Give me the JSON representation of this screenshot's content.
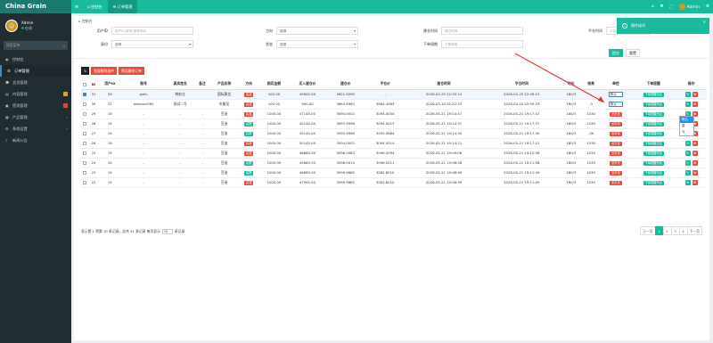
{
  "app": {
    "title": "China Grain"
  },
  "user": {
    "name": "Admin",
    "status": "在线",
    "short": "Admin"
  },
  "sidebar": {
    "search_placeholder": "搜索菜单",
    "items": [
      {
        "label": "控制台",
        "icon": "dashboard-icon"
      },
      {
        "label": "订单管理",
        "icon": "list-icon",
        "active": true
      },
      {
        "label": "会员管理",
        "icon": "user-icon"
      },
      {
        "label": "内容管理",
        "icon": "file-icon",
        "badge": "orange"
      },
      {
        "label": "提现管理",
        "icon": "wallet-icon",
        "badge": "red"
      },
      {
        "label": "产品管理",
        "icon": "box-icon",
        "chevron": true
      },
      {
        "label": "系统设置",
        "icon": "gear-icon",
        "chevron": true
      },
      {
        "label": "新闻公告",
        "icon": "bell-icon"
      }
    ]
  },
  "topbar": {
    "tabs": [
      {
        "label": "控制台"
      },
      {
        "label": "订单管理"
      }
    ],
    "username": "Admin"
  },
  "breadcrumb": "控制台",
  "filters": {
    "user_id": {
      "label": "用户ID",
      "placeholder": "用户ID/账号/推荐号码"
    },
    "direction": {
      "label": "方向",
      "value": "选择"
    },
    "close_time": {
      "label": "建仓时间",
      "placeholder": "建仓时间"
    },
    "close_price": {
      "label": "平仓时间",
      "placeholder": "平仓时间"
    },
    "proxy": {
      "label": "身份",
      "value": "选择"
    },
    "status": {
      "label": "状态",
      "value": "选择"
    },
    "order_time": {
      "label": "下单周期",
      "placeholder": "下单周期"
    },
    "submit": "提交",
    "reset": "重置"
  },
  "toolbar": {
    "refresh_icon": "refresh-icon",
    "bulk_delete": "批量删除选中",
    "pre_delete": "预设删除订单"
  },
  "table": {
    "headers": [
      "ID",
      "用户ID",
      "账号",
      "真实姓名",
      "备注",
      "产品名称",
      "方向",
      "购买金额",
      "买入建仓价",
      "建仓价",
      "平仓价",
      "建仓时间",
      "平仓时间",
      "时长",
      "结果",
      "单控",
      "下单提醒",
      "操作"
    ],
    "rows": [
      {
        "id": "31",
        "uid": "29",
        "acct": "gxlin",
        "name": "韩杜仕",
        "note": "",
        "product": "国际黄金",
        "dir": "买涨",
        "amount": "100.00",
        "buy": "49900.00",
        "open": "4621.9295",
        "close": "-",
        "t1": "2026-03-25 22:35:14",
        "t2": "2026-03-25 22:40:13",
        "dur": "180/3",
        "res": "",
        "ctrl": "默认",
        "remind": "下单提醒开启",
        "selected": true
      },
      {
        "id": "30",
        "uid": "21",
        "acct": "testuser062",
        "name": "测试二号",
        "note": "",
        "product": "车厘吴",
        "dir": "买涨",
        "amount": "100.00",
        "buy": "900.00",
        "open": "3664.4983",
        "close": "3664.4983",
        "t1": "2026-03-10 02:52:23",
        "t2": "2026-03-10 02:55:23",
        "dur": "180/3",
        "res": "-3",
        "ctrl": "默认",
        "remind": "下单提醒开启"
      },
      {
        "id": "29",
        "uid": "19",
        "acct": "-",
        "name": "-",
        "note": "-",
        "product": "豆油",
        "dir": "买涨",
        "amount": "1000.00",
        "buy": "47145.00",
        "open": "3094.0002",
        "close": "3094.0004",
        "t1": "2026-05-21 19:14:47",
        "t2": "2026-05-21 19:17:47",
        "dur": "180/3",
        "res": "1030",
        "ctrl": "全平仓",
        "remind": "下单提醒开启"
      },
      {
        "id": "28",
        "uid": "19",
        "acct": "-",
        "name": "-",
        "note": "-",
        "product": "豆油",
        "dir": "买跌",
        "amount": "1000.00",
        "buy": "45145.00",
        "open": "3093.9996",
        "close": "3094.0013",
        "t1": "2026-05-21 19:14:37",
        "t2": "2026-05-21 19:17:37",
        "dur": "180/3",
        "res": "1030",
        "ctrl": "全平仓",
        "remind": "下单提醒开启"
      },
      {
        "id": "27",
        "uid": "19",
        "acct": "-",
        "name": "-",
        "note": "-",
        "product": "豆油",
        "dir": "买跌",
        "amount": "1000.00",
        "buy": "45145.00",
        "open": "3093.9996",
        "close": "3093.9984",
        "t1": "2026-05-21 19:14:30",
        "t2": "2026-05-21 19:17:30",
        "dur": "180/3",
        "res": "-30",
        "ctrl": "全平仓",
        "remind": "下单提醒开启"
      },
      {
        "id": "26",
        "uid": "19",
        "acct": "-",
        "name": "-",
        "note": "-",
        "product": "豆油",
        "dir": "买涨",
        "amount": "1000.00",
        "buy": "50145.00",
        "open": "3094.0002",
        "close": "3094.0014",
        "t1": "2026-05-21 19:14:21",
        "t2": "2026-05-21 19:17:21",
        "dur": "180/3",
        "res": "1030",
        "ctrl": "全平仓",
        "remind": "下单提醒开启"
      },
      {
        "id": "25",
        "uid": "19",
        "acct": "-",
        "name": "-",
        "note": "-",
        "product": "豆油",
        "dir": "买涨",
        "amount": "1000.00",
        "buy": "46860.00",
        "open": "3096.0083",
        "close": "3096.0094",
        "t1": "2026-05-21 19:09:06",
        "t2": "2026-05-21 19:12:06",
        "dur": "180/3",
        "res": "1030",
        "ctrl": "全平仓",
        "remind": "下单提醒开启"
      },
      {
        "id": "24",
        "uid": "19",
        "acct": "-",
        "name": "-",
        "note": "-",
        "product": "豆油",
        "dir": "买跌",
        "amount": "1000.00",
        "buy": "45860.00",
        "open": "3096.0014",
        "close": "3096.0011",
        "t1": "2026-05-21 19:08:58",
        "t2": "2026-05-21 19:11:58",
        "dur": "180/3",
        "res": "1030",
        "ctrl": "全平仓",
        "remind": "下单提醒开启"
      },
      {
        "id": "23",
        "uid": "19",
        "acct": "-",
        "name": "-",
        "note": "-",
        "product": "豆油",
        "dir": "买跌",
        "amount": "1000.00",
        "buy": "46860.00",
        "open": "3099.9885",
        "close": "3082.6010",
        "t1": "2026-05-21 19:08:49",
        "t2": "2026-05-21 19:11:49",
        "dur": "180/3",
        "res": "1030",
        "ctrl": "全平仓",
        "remind": "下单提醒开启"
      },
      {
        "id": "22",
        "uid": "19",
        "acct": "-",
        "name": "-",
        "note": "-",
        "product": "豆油",
        "dir": "买涨",
        "amount": "1000.00",
        "buy": "47900.00",
        "open": "3099.9885",
        "close": "3082.6010",
        "t1": "2026-05-21 19:08:49",
        "t2": "2026-05-21 19:11:49",
        "dur": "180/3",
        "res": "1030",
        "ctrl": "全平仓",
        "remind": "下单提醒开启"
      }
    ]
  },
  "dropdown": {
    "options": [
      "默认",
      "赢",
      "亏"
    ]
  },
  "footer": {
    "info_prefix": "显示第 1 到第 10 条记录，总共 31 条记录 每页显示",
    "page_size": "10",
    "info_suffix": "条记录"
  },
  "pager": {
    "prev": "上一页",
    "pages": [
      "1",
      "2",
      "3",
      "4"
    ],
    "next": "下一页"
  },
  "toast": {
    "text": "操作成功"
  },
  "colors": {
    "brand": "#18bc9c",
    "sidebar": "#222d32",
    "danger": "#e74c3c"
  }
}
